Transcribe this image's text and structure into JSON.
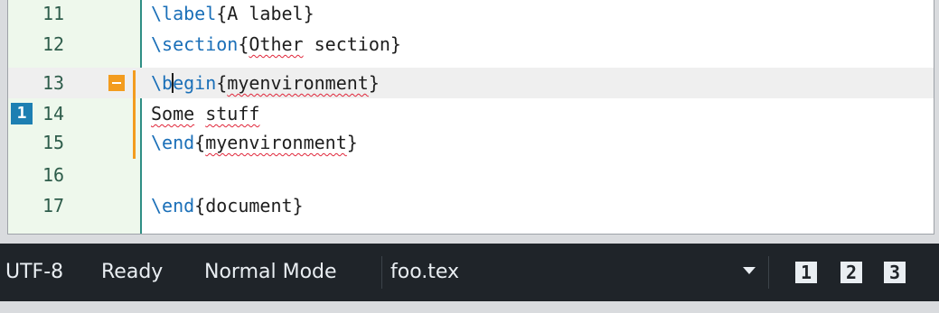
{
  "editor": {
    "lines": [
      {
        "num": "11",
        "code": [
          {
            "t": "\\label",
            "k": "kw"
          },
          {
            "t": "{A label}",
            "k": ""
          }
        ]
      },
      {
        "num": "12",
        "code": [
          {
            "t": "\\section",
            "k": "kw"
          },
          {
            "t": "{",
            "k": ""
          },
          {
            "t": "Other",
            "k": "sp"
          },
          {
            "t": " section}",
            "k": ""
          }
        ]
      },
      {
        "num": "13",
        "code": [
          {
            "t": "\\b",
            "k": "kw"
          },
          {
            "t": "",
            "k": "caret"
          },
          {
            "t": "egin",
            "k": "kw"
          },
          {
            "t": "{",
            "k": ""
          },
          {
            "t": "myenvironment",
            "k": "sp"
          },
          {
            "t": "}",
            "k": ""
          }
        ]
      },
      {
        "num": "14",
        "code": [
          {
            "t": "Some",
            "k": "sp"
          },
          {
            "t": " ",
            "k": ""
          },
          {
            "t": "stuff",
            "k": "sp"
          }
        ]
      },
      {
        "num": "15",
        "code": [
          {
            "t": "\\end",
            "k": "kw"
          },
          {
            "t": "{",
            "k": ""
          },
          {
            "t": "myenvironment",
            "k": "sp"
          },
          {
            "t": "}",
            "k": ""
          }
        ]
      },
      {
        "num": "16",
        "code": []
      },
      {
        "num": "17",
        "code": [
          {
            "t": "\\end",
            "k": "kw"
          },
          {
            "t": "{document}",
            "k": ""
          }
        ]
      }
    ],
    "current_line": "13",
    "bookmark_label": "1"
  },
  "status": {
    "encoding": "UTF-8",
    "state": "Ready",
    "mode": "Normal Mode",
    "filename": "foo.tex",
    "views": [
      "1",
      "2",
      "3"
    ]
  },
  "colors": {
    "keyword": "#1a6fb8",
    "gutter_bg": "#eef8ec",
    "fold_marker": "#f39c1f",
    "bookmark": "#1d7fb2",
    "statusbar_bg": "#1f2429",
    "spell_underline": "#e0263a"
  },
  "icons": {
    "fold": "fold-collapse-icon",
    "bookmark": "bookmark-icon",
    "dropdown": "chevron-down-icon"
  }
}
